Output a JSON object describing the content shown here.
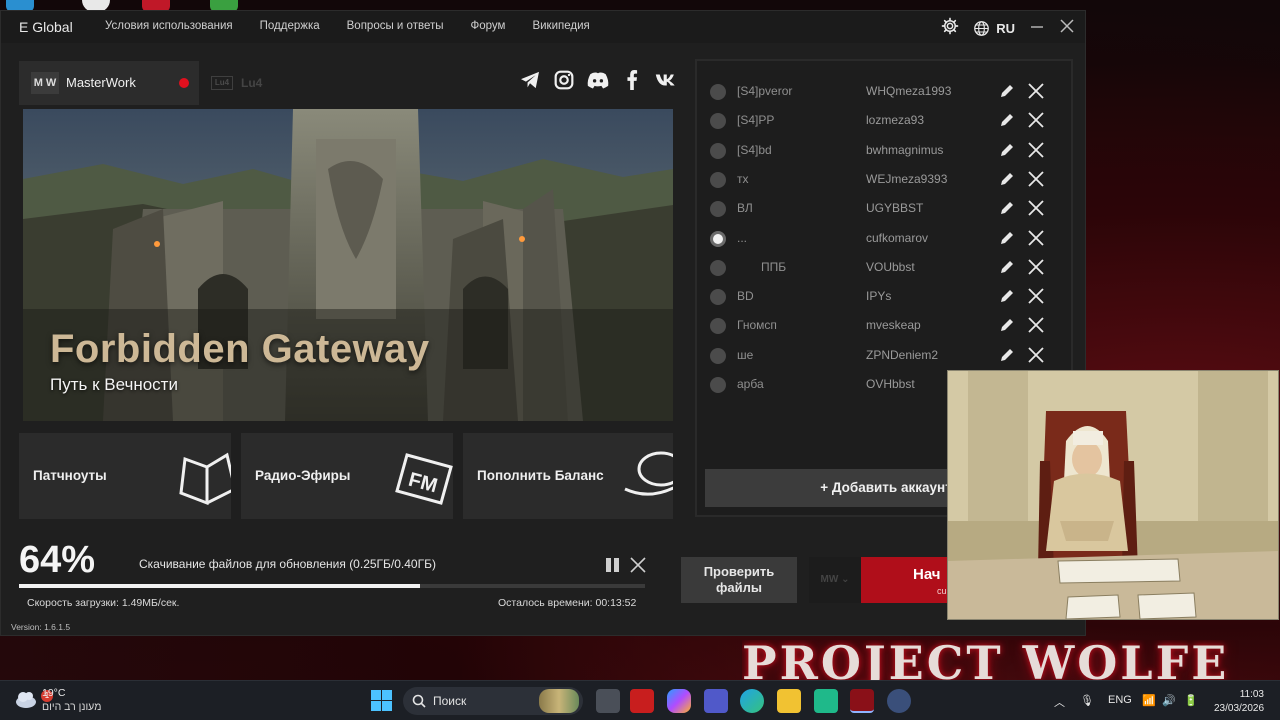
{
  "window": {
    "brand": "E Global",
    "nav": [
      "Условия использования",
      "Поддержка",
      "Вопросы и ответы",
      "Форум",
      "Википедия"
    ],
    "language": "RU"
  },
  "tabs": {
    "active_logo": "M W",
    "active_label": "MasterWork",
    "inactive_logo": "Lu4",
    "inactive_label": "Lu4"
  },
  "banner": {
    "title": "Forbidden Gateway",
    "subtitle": "Путь к Вечности"
  },
  "tiles": [
    {
      "label": "Патчноуты",
      "icon": "book-icon"
    },
    {
      "label": "Радио-Эфиры",
      "icon": "fm-radio-icon"
    },
    {
      "label": "Пополнить Баланс",
      "icon": "coin-icon"
    }
  ],
  "accounts": {
    "rows": [
      {
        "name": "[S4]pveror",
        "login": "WHQmeza1993",
        "selected": false
      },
      {
        "name": "[S4]PP",
        "login": "lozmeza93",
        "selected": false
      },
      {
        "name": "[S4]bd",
        "login": "bwhmagnimus",
        "selected": false
      },
      {
        "name": "тх",
        "login": "WEJmeza9393",
        "selected": false
      },
      {
        "name": "ВЛ",
        "login": "UGYBBST",
        "selected": false
      },
      {
        "name": "...",
        "login": "cufkomarov",
        "selected": true
      },
      {
        "name": "ППБ",
        "login": "VOUbbst",
        "selected": false
      },
      {
        "name": "BD",
        "login": "IPYs",
        "selected": false
      },
      {
        "name": "Гномсп",
        "login": "mveskeap",
        "selected": false
      },
      {
        "name": "ше",
        "login": "ZPNDeniem2",
        "selected": false
      },
      {
        "name": "арба",
        "login": "OVHbbst",
        "selected": false
      }
    ],
    "add_label": "+ Добавить аккаунт"
  },
  "download": {
    "percent_label": "64%",
    "progress": 0.64,
    "status": "Скачивание файлов для обновления (0.25ГБ/0.40ГБ)",
    "speed": "Скорость загрузки: 1.49МБ/сек.",
    "remaining": "Осталось времени: 00:13:52"
  },
  "version": "Version: 1.6.1.5",
  "buttons": {
    "check": "Проверить файлы",
    "server_select": "MW",
    "start_label": "Нач",
    "start_sub": "cu"
  },
  "wallpaper_text": "PROJECT WOLFE",
  "taskbar": {
    "notification_count": "1",
    "temperature": "19°C",
    "weather_desc": "מעונן רב היום",
    "search_placeholder": "Поиск",
    "input_lang": "ENG",
    "time": "11:03",
    "date": "23/03/2026"
  },
  "colors": {
    "accent_red": "#b00e1a",
    "window_bg": "#1f1f1f",
    "panel_bg": "#2b2b2b"
  }
}
